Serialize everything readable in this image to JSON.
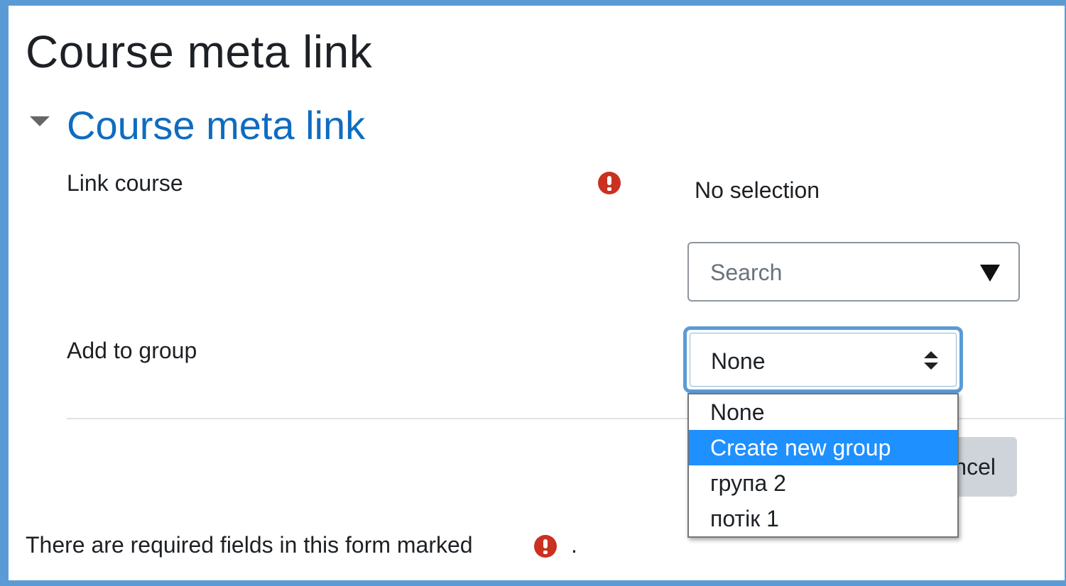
{
  "page": {
    "title": "Course meta link"
  },
  "section": {
    "title": "Course meta link"
  },
  "fields": {
    "link_course": {
      "label": "Link course",
      "required_icon": "exclamation-circle-icon",
      "selection_text": "No selection",
      "search_placeholder": "Search"
    },
    "add_to_group": {
      "label": "Add to group",
      "selected": "None",
      "options": [
        "None",
        "Create new group",
        "група 2",
        "потік 1"
      ],
      "highlighted_option": "Create new group"
    }
  },
  "buttons": {
    "cancel_visible_text": "ncel"
  },
  "footer": {
    "required_note": "There are required fields in this form marked",
    "period": "."
  },
  "colors": {
    "border_accent": "#5b9bd5",
    "section_link": "#0f6cbf",
    "required_icon": "#ca3120",
    "option_highlight": "#1e90ff"
  }
}
